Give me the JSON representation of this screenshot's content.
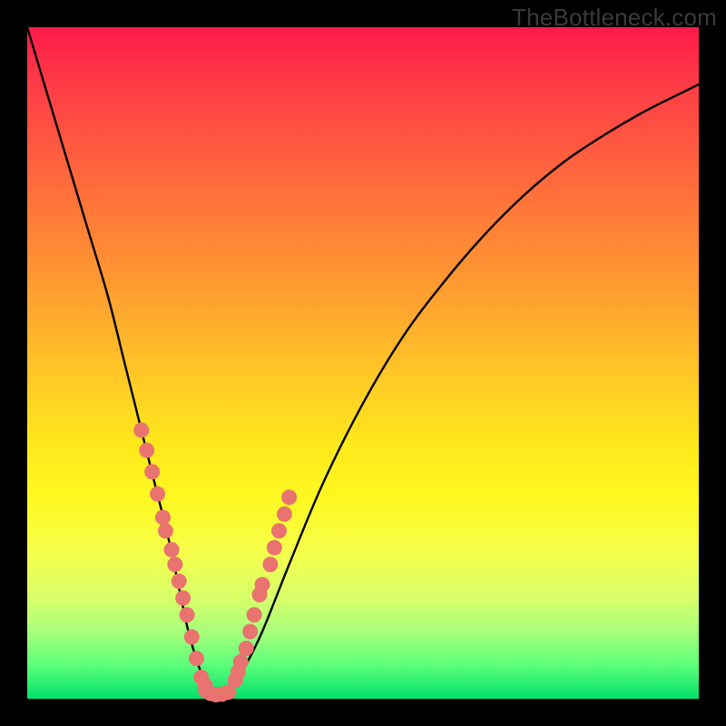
{
  "watermark": "TheBottleneck.com",
  "colors": {
    "frame": "#000000",
    "curve": "#000000",
    "marker_fill": "#e9736e",
    "marker_stroke": "#cf5a56",
    "gradient_top": "#ff1a4b",
    "gradient_bottom": "#00e06a"
  },
  "chart_data": {
    "type": "line",
    "title": "",
    "xlabel": "",
    "ylabel": "",
    "xlim": [
      0,
      100
    ],
    "ylim": [
      0,
      100
    ],
    "grid": false,
    "legend": false,
    "series": [
      {
        "name": "bottleneck-curve",
        "x": [
          0,
          3,
          6,
          9,
          12,
          14.5,
          17,
          19,
          21,
          22.5,
          24,
          25.5,
          27,
          28.5,
          30,
          32,
          35,
          39,
          44,
          50,
          56,
          62,
          68,
          74,
          80,
          86,
          92,
          98,
          100
        ],
        "y": [
          100,
          90,
          80,
          70,
          60,
          50,
          40,
          32,
          24,
          17,
          10,
          5,
          1,
          0.5,
          1,
          4,
          10,
          20,
          32,
          44,
          54,
          62,
          69,
          75,
          80,
          84,
          87.5,
          90.5,
          91.5
        ]
      }
    ],
    "markers": {
      "name": "sample-points",
      "note": "pink dotted clusters along the V near the bottom",
      "x": [
        17.0,
        17.8,
        18.6,
        19.4,
        20.2,
        20.6,
        21.5,
        22,
        22.6,
        23.2,
        23.8,
        24.5,
        25.2,
        25.9,
        26.5,
        26.6,
        27.3,
        28.1,
        29.0,
        30.0,
        31.0,
        31.4,
        31.8,
        32.6,
        33.2,
        33.8,
        34.6,
        35.0,
        36.2,
        36.8,
        37.5,
        38.3,
        39.0
      ],
      "y": [
        40.0,
        37.0,
        33.8,
        30.5,
        27.0,
        25,
        22.2,
        20,
        17.5,
        15.0,
        12.5,
        9.2,
        6.0,
        3.2,
        2,
        1.2,
        0.8,
        0.6,
        0.7,
        1.0,
        2.8,
        4,
        5.5,
        7.5,
        10.0,
        12.5,
        15.5,
        17,
        20.0,
        22.5,
        25,
        27.5,
        30.0
      ]
    }
  }
}
